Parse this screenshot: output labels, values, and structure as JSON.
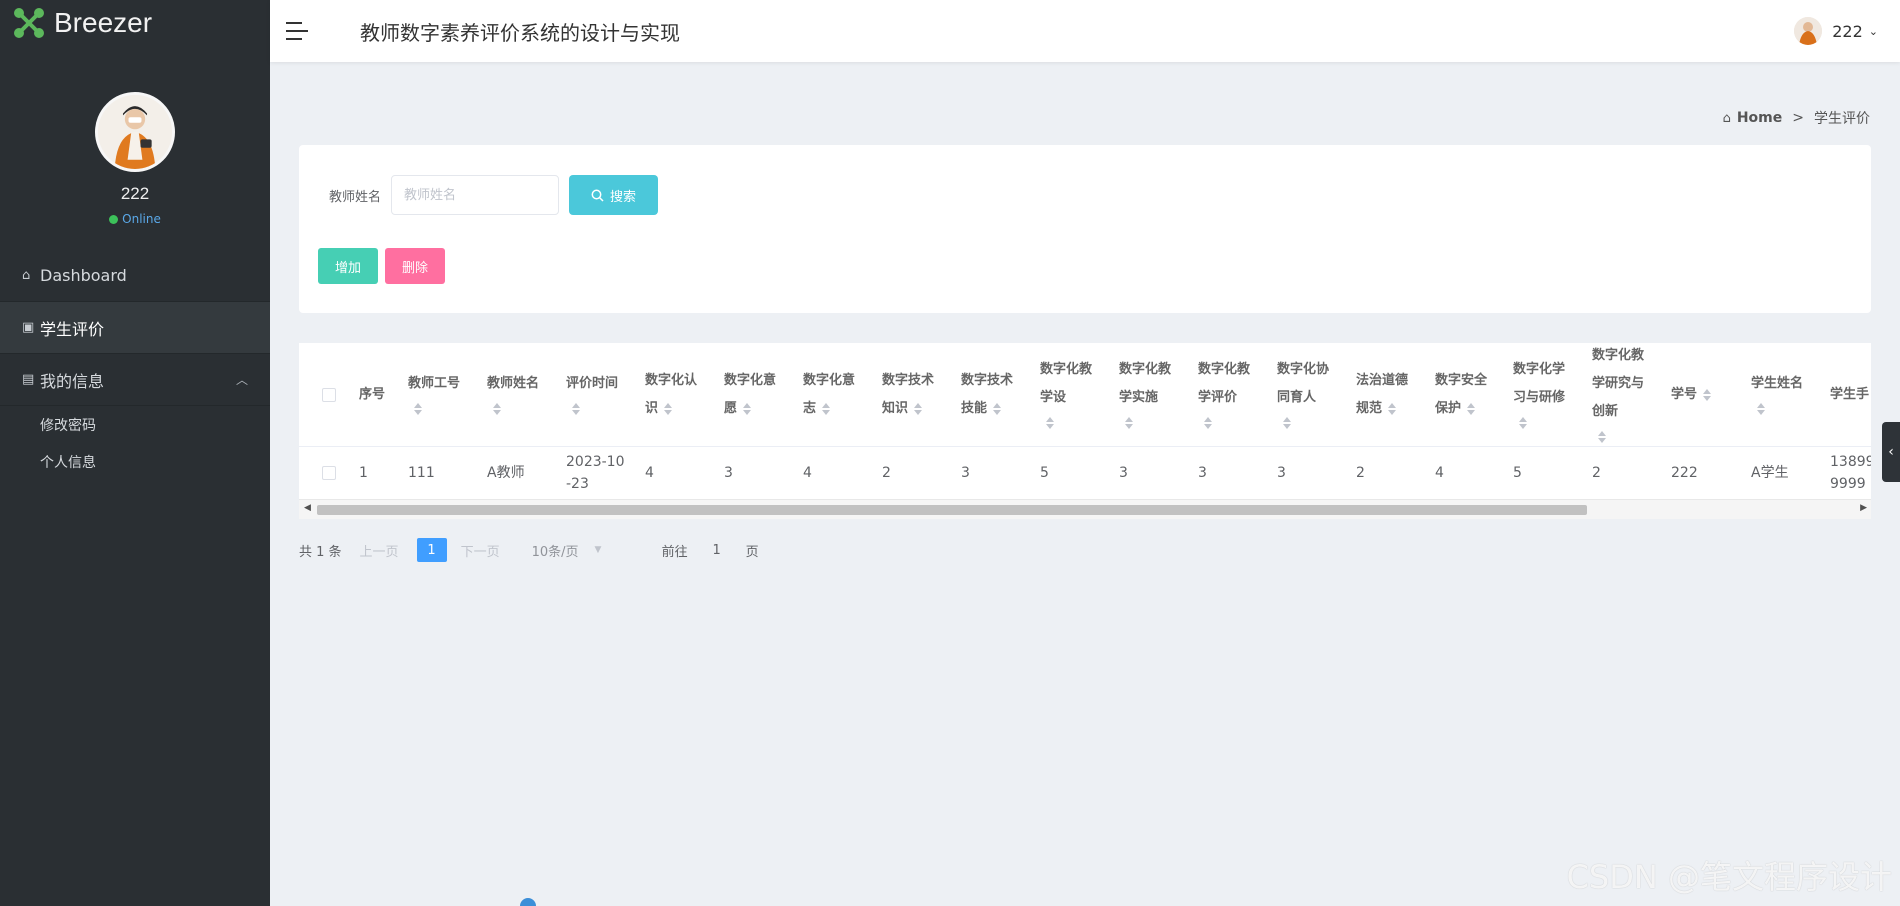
{
  "brand": {
    "name": "Breezer",
    "icon": "molecule-logo-icon",
    "accent": "#5cb85c"
  },
  "sidebar": {
    "profile": {
      "name": "222",
      "status": "Online"
    },
    "items": [
      {
        "label": "Dashboard",
        "icon": "home-icon"
      },
      {
        "label": "学生评价",
        "icon": "document-icon",
        "active": true
      },
      {
        "label": "我的信息",
        "icon": "panel-icon",
        "expanded": true
      }
    ],
    "sub_items": [
      {
        "label": "修改密码"
      },
      {
        "label": "个人信息"
      }
    ]
  },
  "header": {
    "title": "教师数字素养评价系统的设计与实现",
    "user": "222"
  },
  "breadcrumb": {
    "home": "Home",
    "separator": ">",
    "current": "学生评价"
  },
  "search": {
    "label": "教师姓名",
    "placeholder": "教师姓名",
    "button": "搜索"
  },
  "actions": {
    "add": "增加",
    "delete": "删除"
  },
  "table": {
    "columns": [
      {
        "key": "seq",
        "l1": "序号",
        "l2": "",
        "l3": "",
        "sortable": false
      },
      {
        "key": "id",
        "l1": "教师工号",
        "l2": "",
        "l3": "",
        "sortable": true
      },
      {
        "key": "name",
        "l1": "教师姓名",
        "l2": "",
        "l3": "",
        "sortable": true
      },
      {
        "key": "time",
        "l1": "评价时间",
        "l2": "",
        "l3": "",
        "sortable": true
      },
      {
        "key": "c1",
        "l1": "数字化认",
        "l2": "识",
        "l3": "",
        "sortable": true
      },
      {
        "key": "c2",
        "l1": "数字化意",
        "l2": "愿",
        "l3": "",
        "sortable": true
      },
      {
        "key": "c3",
        "l1": "数字化意",
        "l2": "志",
        "l3": "",
        "sortable": true
      },
      {
        "key": "c4",
        "l1": "数字技术",
        "l2": "知识",
        "l3": "",
        "sortable": true
      },
      {
        "key": "c5",
        "l1": "数字技术",
        "l2": "技能",
        "l3": "",
        "sortable": true
      },
      {
        "key": "c6",
        "l1": "数字化教",
        "l2": "学设",
        "l3": "",
        "sortable": true
      },
      {
        "key": "c7",
        "l1": "数字化教",
        "l2": "学实施",
        "l3": "",
        "sortable": true
      },
      {
        "key": "c8",
        "l1": "数字化教",
        "l2": "学评价",
        "l3": "",
        "sortable": true
      },
      {
        "key": "c9",
        "l1": "数字化协",
        "l2": "同育人",
        "l3": "",
        "sortable": true
      },
      {
        "key": "c10",
        "l1": "法治道德",
        "l2": "规范",
        "l3": "",
        "sortable": true
      },
      {
        "key": "c11",
        "l1": "数字安全",
        "l2": "保护",
        "l3": "",
        "sortable": true
      },
      {
        "key": "c12",
        "l1": "数字化学",
        "l2": "习与研修",
        "l3": "",
        "sortable": true
      },
      {
        "key": "c13",
        "l1": "数字化教",
        "l2": "学研究与",
        "l3": "创新",
        "sortable": true
      },
      {
        "key": "sno",
        "l1": "学号",
        "l2": "",
        "l3": "",
        "sortable": true
      },
      {
        "key": "sname",
        "l1": "学生姓名",
        "l2": "",
        "l3": "",
        "sortable": true
      },
      {
        "key": "sphone",
        "l1": "学生手",
        "l2": "",
        "l3": "",
        "sortable": false
      }
    ],
    "rows": [
      {
        "seq": "1",
        "id": "111",
        "name": "A教师",
        "time_l1": "2023-10",
        "time_l2": "-23",
        "c1": "4",
        "c2": "3",
        "c3": "4",
        "c4": "2",
        "c5": "3",
        "c6": "5",
        "c7": "3",
        "c8": "3",
        "c9": "3",
        "c10": "2",
        "c11": "4",
        "c12": "5",
        "c13": "2",
        "sno": "222",
        "sname": "A学生",
        "sphone_l1": "13899",
        "sphone_l2": "9999"
      }
    ]
  },
  "pagination": {
    "total": "共 1 条",
    "prev": "上一页",
    "current": "1",
    "next": "下一页",
    "page_size": "10条/页",
    "goto": "前往",
    "goto_value": "1",
    "page_suffix": "页"
  },
  "watermark": "CSDN @笔文程序设计"
}
